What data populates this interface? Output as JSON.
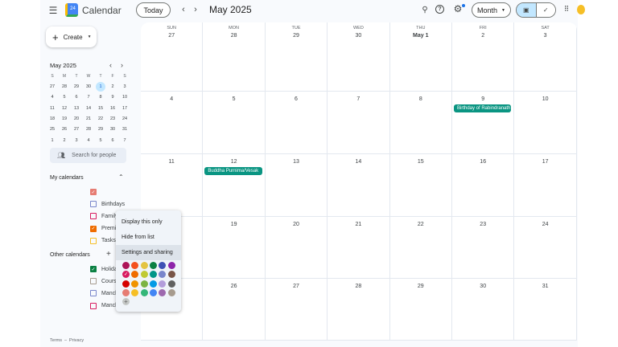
{
  "header": {
    "app_title": "Calendar",
    "logo_text": "24",
    "today": "Today",
    "month_title": "May 2025",
    "view": "Month"
  },
  "create": "Create",
  "mini_cal": {
    "title": "May 2025",
    "dows": [
      "S",
      "M",
      "T",
      "W",
      "T",
      "F",
      "S"
    ],
    "weeks": [
      [
        "27",
        "28",
        "29",
        "30",
        "1",
        "2",
        "3"
      ],
      [
        "4",
        "5",
        "6",
        "7",
        "8",
        "9",
        "10"
      ],
      [
        "11",
        "12",
        "13",
        "14",
        "15",
        "16",
        "17"
      ],
      [
        "18",
        "19",
        "20",
        "21",
        "22",
        "23",
        "24"
      ],
      [
        "25",
        "26",
        "27",
        "28",
        "29",
        "30",
        "31"
      ],
      [
        "1",
        "2",
        "3",
        "4",
        "5",
        "6",
        "7"
      ]
    ],
    "today": "1"
  },
  "search_people": "Search for people",
  "my_calendars": {
    "title": "My calendars",
    "items": [
      {
        "label": "",
        "color": "#e67c73",
        "checked": true
      },
      {
        "label": "Birthdays",
        "color": "#7986cb",
        "checked": false
      },
      {
        "label": "Family",
        "color": "#d81b60",
        "checked": false
      },
      {
        "label": "Premier League",
        "color": "#ef6c00",
        "checked": true
      },
      {
        "label": "Tasks",
        "color": "#f6bf26",
        "checked": false
      }
    ]
  },
  "other_calendars": {
    "title": "Other calendars",
    "items": [
      {
        "label": "Holidays in India",
        "color": "#0b8043",
        "checked": true
      },
      {
        "label": "Coursera Calendar - Ni",
        "color": "#a79b8e",
        "checked": false
      },
      {
        "label": "Manchester United Ma",
        "color": "#7986cb",
        "checked": false
      },
      {
        "label": "Manchester United Me",
        "color": "#d81b60",
        "checked": false
      }
    ]
  },
  "footer": {
    "terms": "Terms",
    "sep": "–",
    "privacy": "Privacy"
  },
  "grid": {
    "dows": [
      "SUN",
      "MON",
      "TUE",
      "WED",
      "THU",
      "FRI",
      "SAT"
    ],
    "weeks": [
      [
        "27",
        "28",
        "29",
        "30",
        "May 1",
        "2",
        "3"
      ],
      [
        "4",
        "5",
        "6",
        "7",
        "8",
        "9",
        "10"
      ],
      [
        "11",
        "12",
        "13",
        "14",
        "15",
        "16",
        "17"
      ],
      [
        "18",
        "19",
        "20",
        "21",
        "22",
        "23",
        "24"
      ],
      [
        "25",
        "26",
        "27",
        "28",
        "29",
        "30",
        "31"
      ]
    ],
    "events": [
      {
        "week": 1,
        "day": 5,
        "title": "Birthday of Rabindranath"
      },
      {
        "week": 2,
        "day": 1,
        "title": "Buddha Purnima/Vesak"
      }
    ]
  },
  "menu": {
    "items": [
      "Display this only",
      "Hide from list",
      "Settings and sharing"
    ],
    "colors": [
      [
        "#ad1457",
        "#f4511e",
        "#e4c441",
        "#0b8043",
        "#3f51b5",
        "#8e24aa"
      ],
      [
        "#d81b60",
        "#ef6c00",
        "#c0ca33",
        "#009688",
        "#7986cb",
        "#795548"
      ],
      [
        "#d50000",
        "#f09300",
        "#7cb342",
        "#039be5",
        "#b39ddb",
        "#616161"
      ],
      [
        "#e67c73",
        "#f6bf26",
        "#33b679",
        "#4285f4",
        "#9e69af",
        "#a79b8e"
      ]
    ],
    "selected_color": "#d81b60",
    "add": "+"
  }
}
